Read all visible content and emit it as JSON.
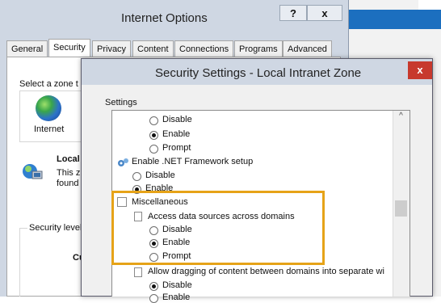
{
  "internet_options": {
    "title": "Internet Options",
    "help_button": "?",
    "close_button": "x",
    "tabs": [
      {
        "label": "General"
      },
      {
        "label": "Security"
      },
      {
        "label": "Privacy"
      },
      {
        "label": "Content"
      },
      {
        "label": "Connections"
      },
      {
        "label": "Programs"
      },
      {
        "label": "Advanced"
      }
    ],
    "zone_prompt": "Select a zone t",
    "zone_internet": "Internet",
    "local_title": "Local",
    "local_desc_1": "This z",
    "local_desc_2": "found",
    "security_level": "Security level",
    "custom_fragment": "Cu"
  },
  "security_settings": {
    "title": "Security Settings - Local Intranet Zone",
    "close_button": "x",
    "settings_label": "Settings",
    "rows": {
      "disable_1": "Disable",
      "enable_1": "Enable",
      "prompt_1": "Prompt",
      "dotnet_setup": "Enable .NET Framework setup",
      "dotnet_disable": "Disable",
      "dotnet_enable": "Enable",
      "misc": "Miscellaneous",
      "access_data": "Access data sources across domains",
      "access_disable": "Disable",
      "access_enable": "Enable",
      "access_prompt": "Prompt",
      "allow_drag": "Allow dragging of content between domains into separate wi",
      "drag_disable": "Disable",
      "drag_enable": "Enable"
    },
    "scroll_up": "^"
  },
  "colors": {
    "highlight": "#e6a318",
    "close_red": "#c7392d",
    "title_bar": "#cfd7e3"
  }
}
